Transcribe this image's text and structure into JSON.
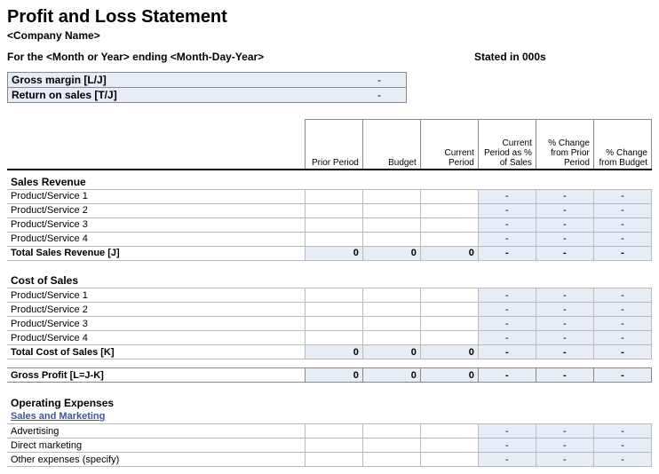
{
  "title": "Profit and Loss Statement",
  "company": "<Company Name>",
  "period_left": "For the <Month or Year> ending <Month-Day-Year>",
  "period_right": "Stated in 000s",
  "metrics": [
    {
      "label": "Gross margin  [L/J]",
      "value": "-"
    },
    {
      "label": "Return on sales  [T/J]",
      "value": "-"
    }
  ],
  "columns": [
    "",
    "Prior Period",
    "Budget",
    "Current Period",
    "Current Period as % of Sales",
    "% Change from Prior Period",
    "% Change from Budget"
  ],
  "sections": [
    {
      "head": "Sales Revenue",
      "rows": [
        {
          "label": "Product/Service 1",
          "vals": [
            "",
            "",
            "",
            "-",
            "-",
            "-"
          ]
        },
        {
          "label": "Product/Service 2",
          "vals": [
            "",
            "",
            "",
            "-",
            "-",
            "-"
          ]
        },
        {
          "label": "Product/Service 3",
          "vals": [
            "",
            "",
            "",
            "-",
            "-",
            "-"
          ]
        },
        {
          "label": "Product/Service 4",
          "vals": [
            "",
            "",
            "",
            "-",
            "-",
            "-"
          ]
        }
      ],
      "total": {
        "label": "Total Sales Revenue  [J]",
        "vals": [
          "0",
          "0",
          "0",
          "-",
          "-",
          "-"
        ]
      }
    },
    {
      "head": "Cost of Sales",
      "rows": [
        {
          "label": "Product/Service 1",
          "vals": [
            "",
            "",
            "",
            "-",
            "-",
            "-"
          ]
        },
        {
          "label": "Product/Service 2",
          "vals": [
            "",
            "",
            "",
            "-",
            "-",
            "-"
          ]
        },
        {
          "label": "Product/Service 3",
          "vals": [
            "",
            "",
            "",
            "-",
            "-",
            "-"
          ]
        },
        {
          "label": "Product/Service 4",
          "vals": [
            "",
            "",
            "",
            "-",
            "-",
            "-"
          ]
        }
      ],
      "total": {
        "label": "Total Cost of Sales  [K]",
        "vals": [
          "0",
          "0",
          "0",
          "-",
          "-",
          "-"
        ]
      }
    }
  ],
  "gross_profit": {
    "label": "Gross Profit  [L=J-K]",
    "vals": [
      "0",
      "0",
      "0",
      "-",
      "-",
      "-"
    ]
  },
  "opex_head": "Operating Expenses",
  "opex_sub": "Sales and Marketing",
  "opex_rows": [
    {
      "label": "Advertising",
      "vals": [
        "",
        "",
        "",
        "-",
        "-",
        "-"
      ]
    },
    {
      "label": "Direct marketing",
      "vals": [
        "",
        "",
        "",
        "-",
        "-",
        "-"
      ]
    },
    {
      "label": "Other expenses (specify)",
      "vals": [
        "",
        "",
        "",
        "-",
        "-",
        "-"
      ]
    }
  ]
}
